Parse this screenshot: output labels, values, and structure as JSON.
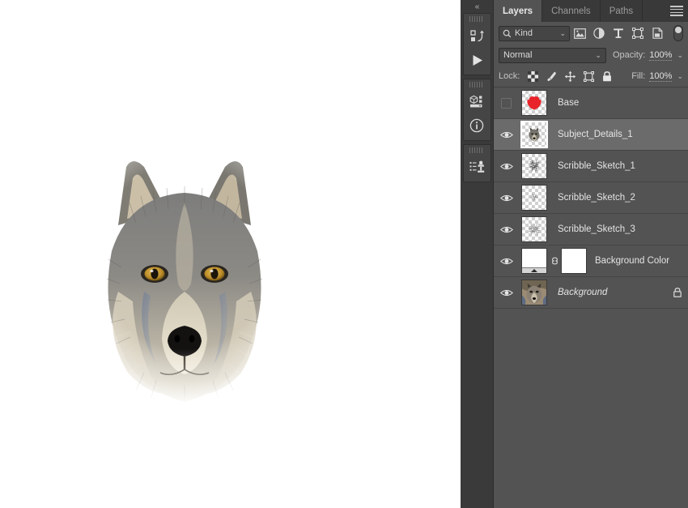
{
  "canvas": {
    "name": "wolf-scribble-artwork",
    "description": "Wolf head photo composite with pencil scribble sketch border",
    "background_color": "#ffffff"
  },
  "tool_rail": {
    "collapse_label": "«",
    "groups": [
      {
        "icons": [
          {
            "name": "actions-icon",
            "label": "Actions"
          },
          {
            "name": "play-icon",
            "label": "Play"
          }
        ]
      },
      {
        "icons": [
          {
            "name": "properties-3d-icon",
            "label": "Properties"
          },
          {
            "name": "info-icon",
            "label": "Info"
          }
        ]
      },
      {
        "icons": [
          {
            "name": "clone-source-icon",
            "label": "Clone Source"
          }
        ]
      }
    ]
  },
  "panel": {
    "tabs": [
      {
        "label": "Layers",
        "active": true
      },
      {
        "label": "Channels",
        "active": false
      },
      {
        "label": "Paths",
        "active": false
      }
    ],
    "menu_icon": "hamburger-menu-icon",
    "filter": {
      "search_icon": "search-icon",
      "kind_label": "Kind",
      "chevron": "⌄",
      "type_filters": [
        {
          "name": "filter-pixel-icon",
          "label": "Pixel layers"
        },
        {
          "name": "filter-adjustment-icon",
          "label": "Adjustment layers"
        },
        {
          "name": "filter-type-icon",
          "label": "Type layers"
        },
        {
          "name": "filter-shape-icon",
          "label": "Shape layers"
        },
        {
          "name": "filter-smart-object-icon",
          "label": "Smart objects"
        }
      ],
      "toggle_name": "filter-toggle-switch"
    },
    "blend": {
      "mode": "Normal",
      "chevron": "⌄",
      "opacity_label": "Opacity:",
      "opacity_value": "100%"
    },
    "lock": {
      "label": "Lock:",
      "buttons": [
        {
          "name": "lock-transparency-icon",
          "label": "Lock transparent pixels"
        },
        {
          "name": "lock-image-icon",
          "label": "Lock image pixels"
        },
        {
          "name": "lock-position-icon",
          "label": "Lock position"
        },
        {
          "name": "lock-artboard-icon",
          "label": "Prevent auto-nesting"
        },
        {
          "name": "lock-all-icon",
          "label": "Lock all"
        }
      ],
      "fill_label": "Fill:",
      "fill_value": "100%"
    },
    "layers": [
      {
        "name": "Base",
        "visible": false,
        "selected": false,
        "locked": false,
        "italic": false,
        "thumb_type": "red-blob",
        "has_mask": false
      },
      {
        "name": "Subject_Details_1",
        "visible": true,
        "selected": true,
        "locked": false,
        "italic": false,
        "thumb_type": "wolf-small",
        "has_mask": false
      },
      {
        "name": "Scribble_Sketch_1",
        "visible": true,
        "selected": false,
        "locked": false,
        "italic": false,
        "thumb_type": "scribble-dense",
        "has_mask": false
      },
      {
        "name": "Scribble_Sketch_2",
        "visible": true,
        "selected": false,
        "locked": false,
        "italic": false,
        "thumb_type": "scribble-light",
        "has_mask": false
      },
      {
        "name": "Scribble_Sketch_3",
        "visible": true,
        "selected": false,
        "locked": false,
        "italic": false,
        "thumb_type": "scribble-medium",
        "has_mask": false
      },
      {
        "name": "Background Color",
        "visible": true,
        "selected": false,
        "locked": false,
        "italic": false,
        "thumb_type": "solid-white-fill",
        "has_mask": true
      },
      {
        "name": "Background",
        "visible": true,
        "selected": false,
        "locked": true,
        "italic": true,
        "thumb_type": "wolf-photo",
        "has_mask": false
      }
    ]
  },
  "colors": {
    "panel_bg": "#535353",
    "header_bg": "#393939",
    "rail_bg": "#3a3a3a",
    "selected_row": "#6b6b6b",
    "text": "#e4e4e4",
    "accent_red": "#e8242a"
  }
}
